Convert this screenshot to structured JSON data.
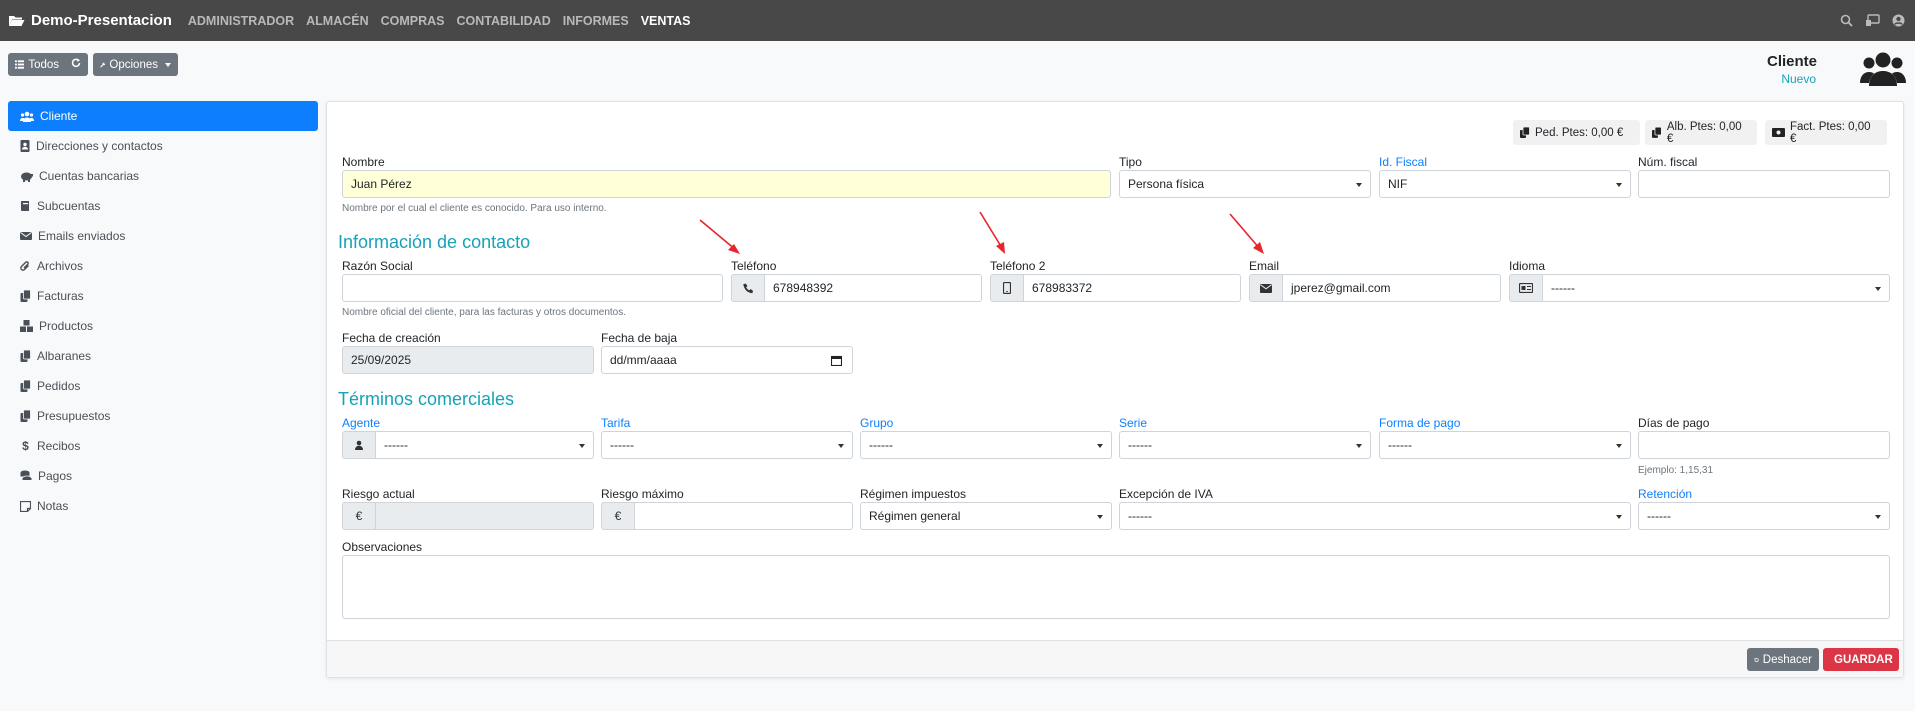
{
  "app": {
    "title": "Demo-Presentacion"
  },
  "nav": {
    "items": [
      {
        "label": "ADMINISTRADOR",
        "active": false
      },
      {
        "label": "ALMACÉN",
        "active": false
      },
      {
        "label": "COMPRAS",
        "active": false
      },
      {
        "label": "CONTABILIDAD",
        "active": false
      },
      {
        "label": "INFORMES",
        "active": false
      },
      {
        "label": "VENTAS",
        "active": true
      }
    ],
    "icons": [
      "search-icon",
      "remote-icon",
      "user-circle-icon"
    ]
  },
  "toolbar": {
    "all_label": "Todos",
    "options_label": "Opciones"
  },
  "page": {
    "title": "Cliente",
    "subtitle": "Nuevo"
  },
  "sidebar": {
    "items": [
      {
        "label": "Cliente",
        "icon": "users-icon",
        "active": true
      },
      {
        "label": "Direcciones y contactos",
        "icon": "address-book-icon"
      },
      {
        "label": "Cuentas bancarias",
        "icon": "piggy-bank-icon"
      },
      {
        "label": "Subcuentas",
        "icon": "book-icon"
      },
      {
        "label": "Emails enviados",
        "icon": "envelope-icon"
      },
      {
        "label": "Archivos",
        "icon": "paperclip-icon"
      },
      {
        "label": "Facturas",
        "icon": "copy-icon"
      },
      {
        "label": "Productos",
        "icon": "cubes-icon"
      },
      {
        "label": "Albaranes",
        "icon": "copy-icon"
      },
      {
        "label": "Pedidos",
        "icon": "copy-icon"
      },
      {
        "label": "Presupuestos",
        "icon": "copy-icon"
      },
      {
        "label": "Recibos",
        "icon": "dollar-icon"
      },
      {
        "label": "Pagos",
        "icon": "coins-icon"
      },
      {
        "label": "Notas",
        "icon": "sticky-note-icon"
      }
    ]
  },
  "badges": {
    "pedidos": "Ped. Ptes: 0,00 €",
    "albaranes": "Alb. Ptes: 0,00 €",
    "facturas": "Fact. Ptes: 0,00 €"
  },
  "form": {
    "nombre": {
      "label": "Nombre",
      "value": "Juan Pérez",
      "help": "Nombre por el cual el cliente es conocido. Para uso interno."
    },
    "tipo": {
      "label": "Tipo",
      "value": "Persona física"
    },
    "id_fiscal": {
      "label": "Id. Fiscal",
      "value": "NIF"
    },
    "num_fiscal": {
      "label": "Núm. fiscal",
      "value": ""
    },
    "contact_section": "Información de contacto",
    "razon_social": {
      "label": "Razón Social",
      "value": "",
      "help": "Nombre oficial del cliente, para las facturas y otros documentos."
    },
    "telefono": {
      "label": "Teléfono",
      "value": "678948392"
    },
    "telefono2": {
      "label": "Teléfono 2",
      "value": "678983372"
    },
    "email": {
      "label": "Email",
      "value": "jperez@gmail.com"
    },
    "idioma": {
      "label": "Idioma",
      "value": "------"
    },
    "fecha_creacion": {
      "label": "Fecha de creación",
      "value": "25/09/2025"
    },
    "fecha_baja": {
      "label": "Fecha de baja",
      "placeholder": "dd/mm/aaaa"
    },
    "commercial_section": "Términos comerciales",
    "agente": {
      "label": "Agente",
      "value": "------"
    },
    "tarifa": {
      "label": "Tarifa",
      "value": "------"
    },
    "grupo": {
      "label": "Grupo",
      "value": "------"
    },
    "serie": {
      "label": "Serie",
      "value": "------"
    },
    "forma_pago": {
      "label": "Forma de pago",
      "value": "------"
    },
    "dias_pago": {
      "label": "Días de pago",
      "value": "",
      "help": "Ejemplo: 1,15,31"
    },
    "riesgo_actual": {
      "label": "Riesgo actual",
      "value": "",
      "addon": "€"
    },
    "riesgo_maximo": {
      "label": "Riesgo máximo",
      "value": "",
      "addon": "€"
    },
    "regimen": {
      "label": "Régimen impuestos",
      "value": "Régimen general"
    },
    "excepcion_iva": {
      "label": "Excepción de IVA",
      "value": "------"
    },
    "retencion": {
      "label": "Retención",
      "value": "------"
    },
    "observaciones": {
      "label": "Observaciones",
      "value": ""
    }
  },
  "footer": {
    "undo_label": "Deshacer",
    "save_label": "GUARDAR"
  },
  "colors": {
    "navbar": "#484848",
    "primary": "#0d7ffe",
    "info": "#17a2b8",
    "danger": "#dc3545",
    "arrow": "#e8242c"
  }
}
